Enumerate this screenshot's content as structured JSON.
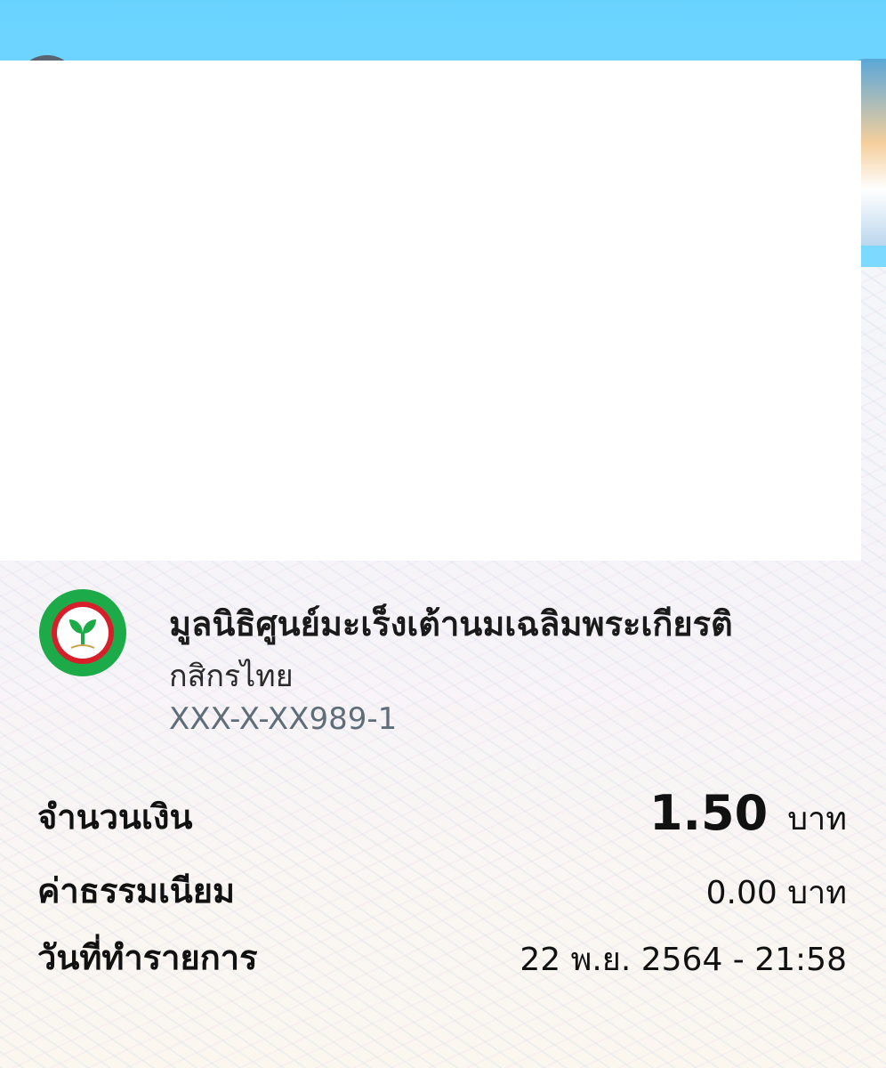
{
  "recipient": {
    "name": "มูลนิธิศูนย์มะเร็งเต้านมเฉลิมพระเกียรติ",
    "bank": "กสิกรไทย",
    "account_number": "XXX-X-XX989-1",
    "bank_logo_icon": "kasikorn-bank-logo"
  },
  "details": {
    "amount_label": "จำนวนเงิน",
    "amount_value": "1.50",
    "amount_unit": "บาท",
    "fee_label": "ค่าธรรมเนียม",
    "fee_value": "0.00 บาท",
    "date_label": "วันที่ทำรายการ",
    "date_value": "22 พ.ย. 2564 - 21:58"
  },
  "colors": {
    "banner": "#69d3ff",
    "logo_green": "#1dab4a",
    "logo_red": "#d71f2b",
    "account_gray": "#5f6d79"
  }
}
